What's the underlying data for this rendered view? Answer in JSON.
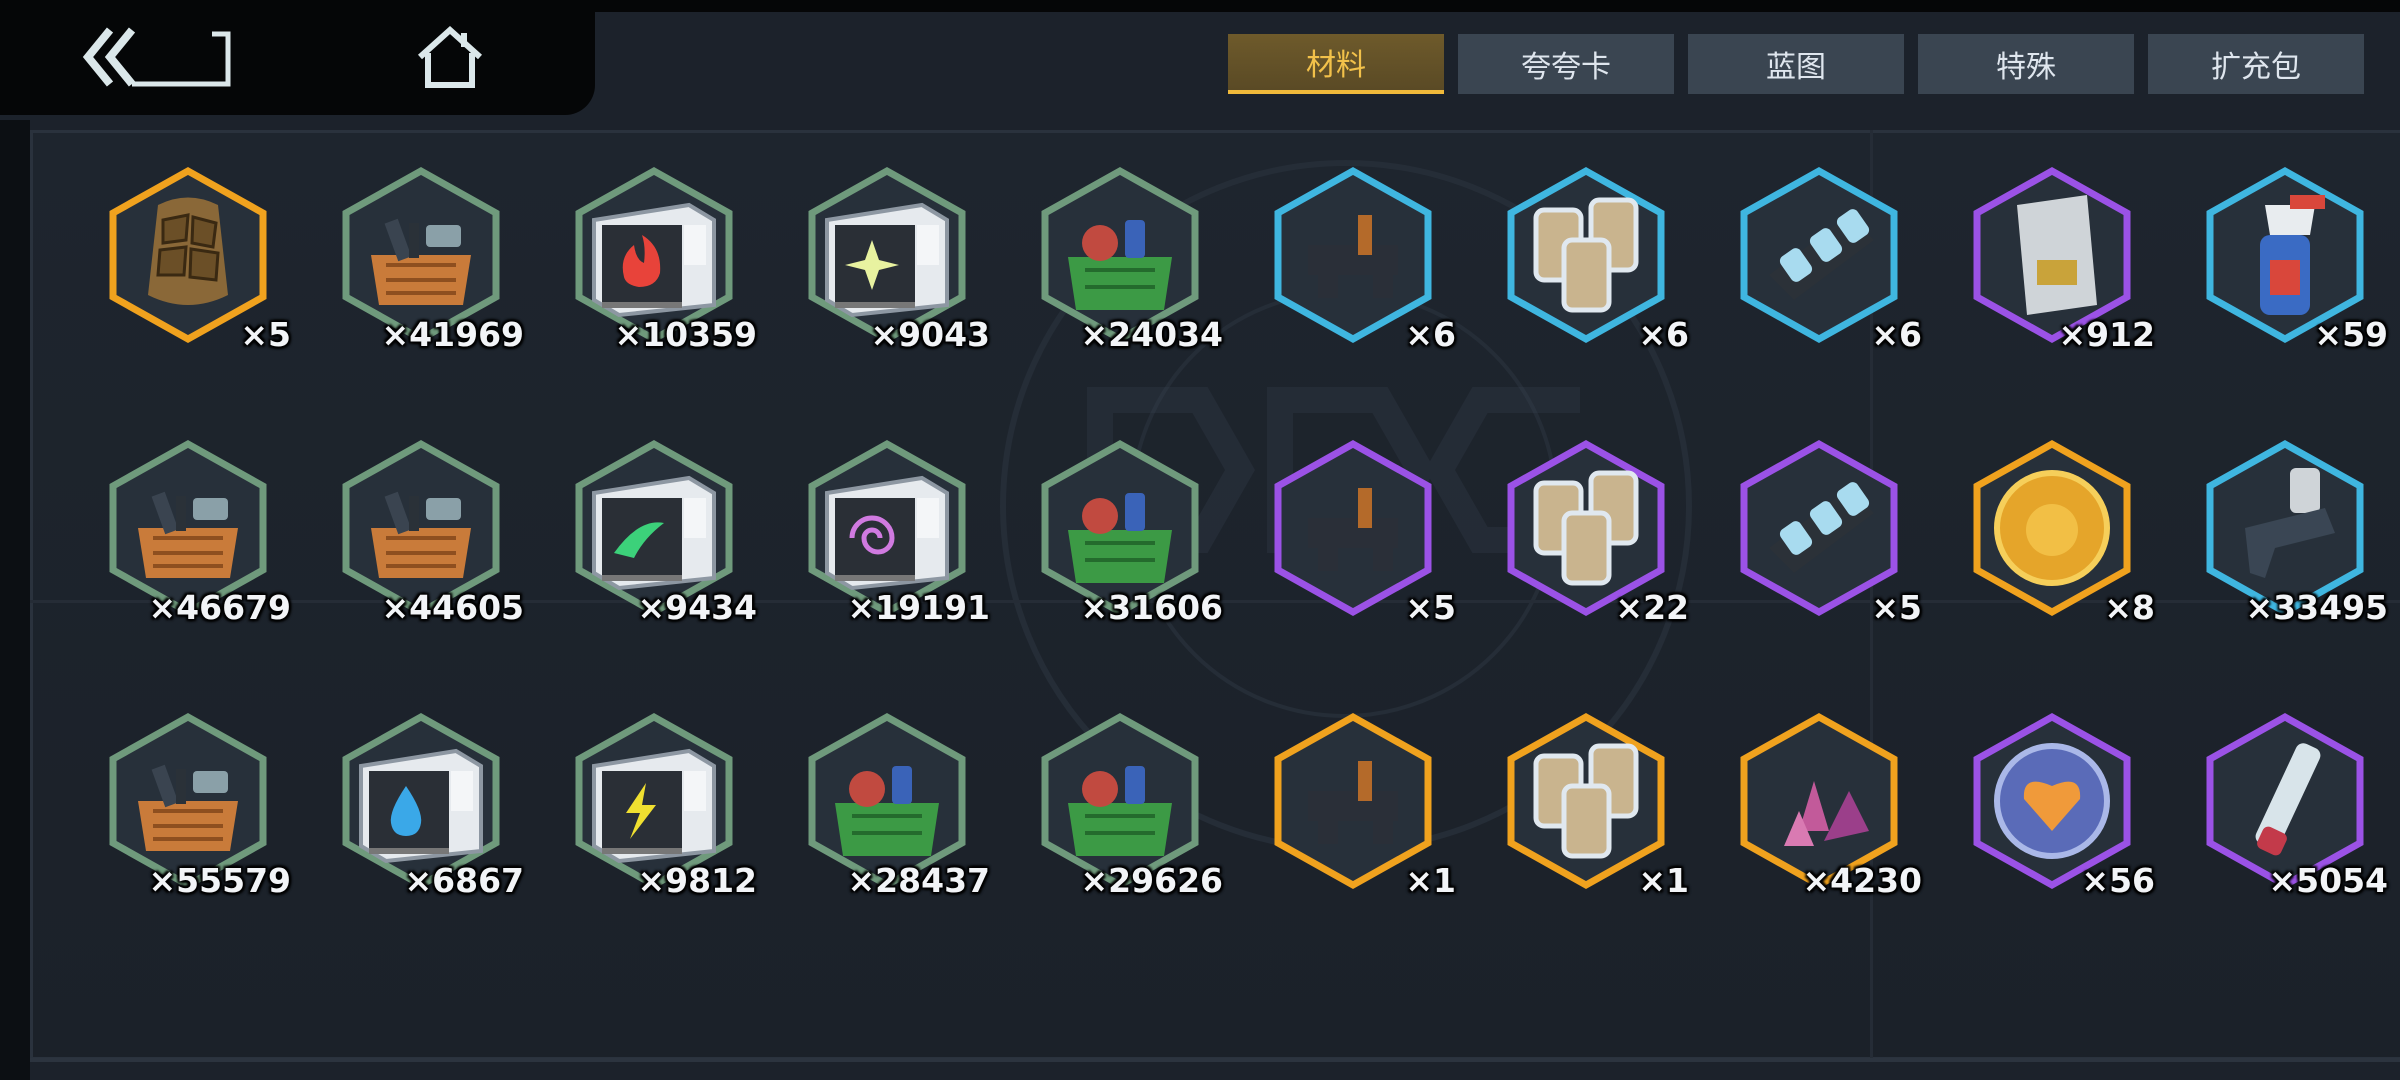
{
  "nav": {
    "back_icon": "back-arrow-icon",
    "home_icon": "home-icon"
  },
  "tabs": [
    {
      "label": "材料",
      "active": true
    },
    {
      "label": "夸夸卡",
      "active": false
    },
    {
      "label": "蓝图",
      "active": false
    },
    {
      "label": "特殊",
      "active": false
    },
    {
      "label": "扩充包",
      "active": false
    }
  ],
  "colors": {
    "gold": "#f0a21e",
    "green": "#6f9a7c",
    "blue": "#3fb6e0",
    "purple": "#9b52e6",
    "tab_active_text": "#f2c14a",
    "tab_bg": "#3a4551"
  },
  "items": [
    {
      "name": "rock-armor",
      "icon": "rock-armor-icon",
      "rarity": "gold",
      "qty": "×5"
    },
    {
      "name": "parts-crate-tools",
      "icon": "parts-crate-icon",
      "rarity": "green",
      "qty": "×41969"
    },
    {
      "name": "fire-module-box",
      "icon": "fire-module-icon",
      "rarity": "green",
      "qty": "×10359"
    },
    {
      "name": "star-module-box",
      "icon": "star-module-icon",
      "rarity": "green",
      "qty": "×9043"
    },
    {
      "name": "green-crate-boots",
      "icon": "supply-crate-icon",
      "rarity": "green",
      "qty": "×24034"
    },
    {
      "name": "blue-machine-part",
      "icon": "machine-part-icon",
      "rarity": "blue",
      "qty": "×6"
    },
    {
      "name": "blue-grain-canisters",
      "icon": "canisters-icon",
      "rarity": "blue",
      "qty": "×6"
    },
    {
      "name": "blue-ice-cells",
      "icon": "ice-cells-icon",
      "rarity": "blue",
      "qty": "×6"
    },
    {
      "name": "memory-card",
      "icon": "memory-card-icon",
      "rarity": "purple",
      "qty": "×912"
    },
    {
      "name": "spray-bottle",
      "icon": "spray-bottle-icon",
      "rarity": "blue",
      "qty": "×59"
    },
    {
      "name": "parts-crate-pipes",
      "icon": "parts-crate-icon",
      "rarity": "green",
      "qty": "×46679"
    },
    {
      "name": "parts-crate-bolts",
      "icon": "parts-crate-icon",
      "rarity": "green",
      "qty": "×44605"
    },
    {
      "name": "wind-module-box",
      "icon": "wind-module-icon",
      "rarity": "green",
      "qty": "×9434"
    },
    {
      "name": "spiral-module-box",
      "icon": "spiral-module-icon",
      "rarity": "green",
      "qty": "×19191"
    },
    {
      "name": "green-crate-fabric",
      "icon": "supply-crate-icon",
      "rarity": "green",
      "qty": "×31606"
    },
    {
      "name": "purple-machine-part",
      "icon": "machine-part-icon",
      "rarity": "purple",
      "qty": "×5"
    },
    {
      "name": "purple-grain-canisters",
      "icon": "canisters-icon",
      "rarity": "purple",
      "qty": "×22"
    },
    {
      "name": "purple-ice-cells",
      "icon": "ice-cells-icon",
      "rarity": "purple",
      "qty": "×5"
    },
    {
      "name": "gold-coin",
      "icon": "coin-icon",
      "rarity": "gold",
      "qty": "×8"
    },
    {
      "name": "spray-gun",
      "icon": "spray-gun-icon",
      "rarity": "blue",
      "qty": "×33495"
    },
    {
      "name": "parts-crate-blue",
      "icon": "parts-crate-icon",
      "rarity": "green",
      "qty": "×55579"
    },
    {
      "name": "water-module-box",
      "icon": "water-module-icon",
      "rarity": "green",
      "qty": "×6867"
    },
    {
      "name": "lightning-module-box",
      "icon": "lightning-module-icon",
      "rarity": "green",
      "qty": "×9812"
    },
    {
      "name": "green-crate-teddy",
      "icon": "supply-crate-icon",
      "rarity": "green",
      "qty": "×28437"
    },
    {
      "name": "green-crate-toys",
      "icon": "supply-crate-icon",
      "rarity": "green",
      "qty": "×29626"
    },
    {
      "name": "gold-machine-part",
      "icon": "machine-part-icon",
      "rarity": "gold",
      "qty": "×1"
    },
    {
      "name": "gold-grain-canisters",
      "icon": "canisters-icon",
      "rarity": "gold",
      "qty": "×1"
    },
    {
      "name": "crystal-shards",
      "icon": "crystal-icon",
      "rarity": "gold",
      "qty": "×4230"
    },
    {
      "name": "heart-badge",
      "icon": "heart-badge-icon",
      "rarity": "purple",
      "qty": "×56"
    },
    {
      "name": "test-tube",
      "icon": "test-tube-icon",
      "rarity": "purple",
      "qty": "×5054"
    }
  ]
}
